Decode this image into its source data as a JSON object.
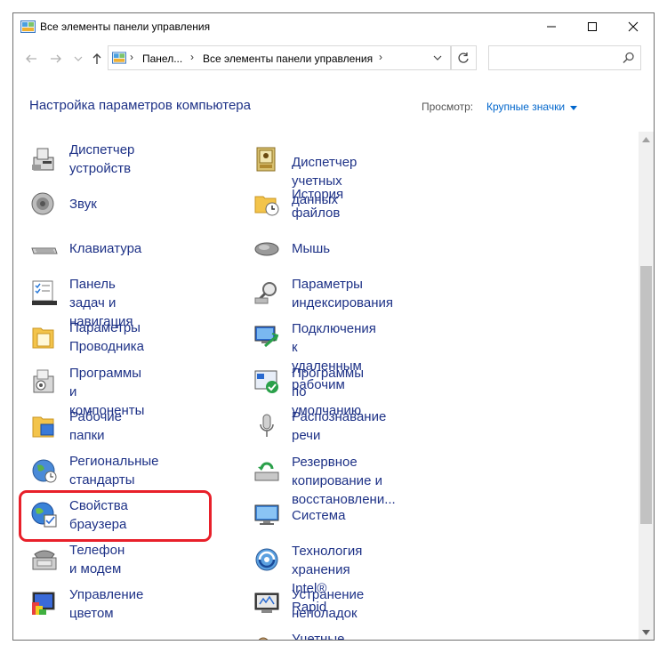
{
  "window": {
    "title": "Все элементы панели управления"
  },
  "address": {
    "crumbs": [
      "Панел...",
      "Все элементы панели управления"
    ],
    "sep": "›"
  },
  "search": {
    "placeholder": "",
    "value": ""
  },
  "header": {
    "title": "Настройка параметров компьютера",
    "view_label": "Просмотр:",
    "view_value": "Крупные значки"
  },
  "items": [
    {
      "label": "Диспетчер устройств",
      "icon": "device-manager-icon"
    },
    {
      "label": "Диспетчер учетных\nданных",
      "icon": "credential-manager-icon"
    },
    {
      "label": "Звук",
      "icon": "speaker-icon"
    },
    {
      "label": "История файлов",
      "icon": "file-history-icon"
    },
    {
      "label": "Клавиатура",
      "icon": "keyboard-icon"
    },
    {
      "label": "Мышь",
      "icon": "mouse-icon"
    },
    {
      "label": "Панель задач и\nнавигация",
      "icon": "taskbar-icon"
    },
    {
      "label": "Параметры\nиндексирования",
      "icon": "indexing-icon"
    },
    {
      "label": "Параметры Проводника",
      "icon": "folder-options-icon"
    },
    {
      "label": "Подключения к\nудаленным рабочим",
      "icon": "remote-desktop-icon"
    },
    {
      "label": "Программы и\nкомпоненты",
      "icon": "programs-icon"
    },
    {
      "label": "Программы по\nумолчанию",
      "icon": "default-programs-icon"
    },
    {
      "label": "Рабочие папки",
      "icon": "work-folders-icon"
    },
    {
      "label": "Распознавание речи",
      "icon": "microphone-icon"
    },
    {
      "label": "Региональные стандарты",
      "icon": "region-icon"
    },
    {
      "label": "Резервное копирование и\nвосстановлени...",
      "icon": "backup-icon"
    },
    {
      "label": "Свойства браузера",
      "icon": "internet-options-icon"
    },
    {
      "label": "Система",
      "icon": "system-icon"
    },
    {
      "label": "Телефон и модем",
      "icon": "phone-modem-icon"
    },
    {
      "label": "Технология хранения\nIntel® Rapid",
      "icon": "intel-rapid-icon"
    },
    {
      "label": "Управление цветом",
      "icon": "color-management-icon"
    },
    {
      "label": "Устранение неполадок",
      "icon": "troubleshooting-icon"
    },
    {
      "label": "",
      "icon": "blank"
    },
    {
      "label": "Учетные записи",
      "icon": "user-accounts-icon"
    }
  ],
  "colors": {
    "link": "#1e3287",
    "accent": "#0066cc",
    "highlight": "#e8202a"
  }
}
